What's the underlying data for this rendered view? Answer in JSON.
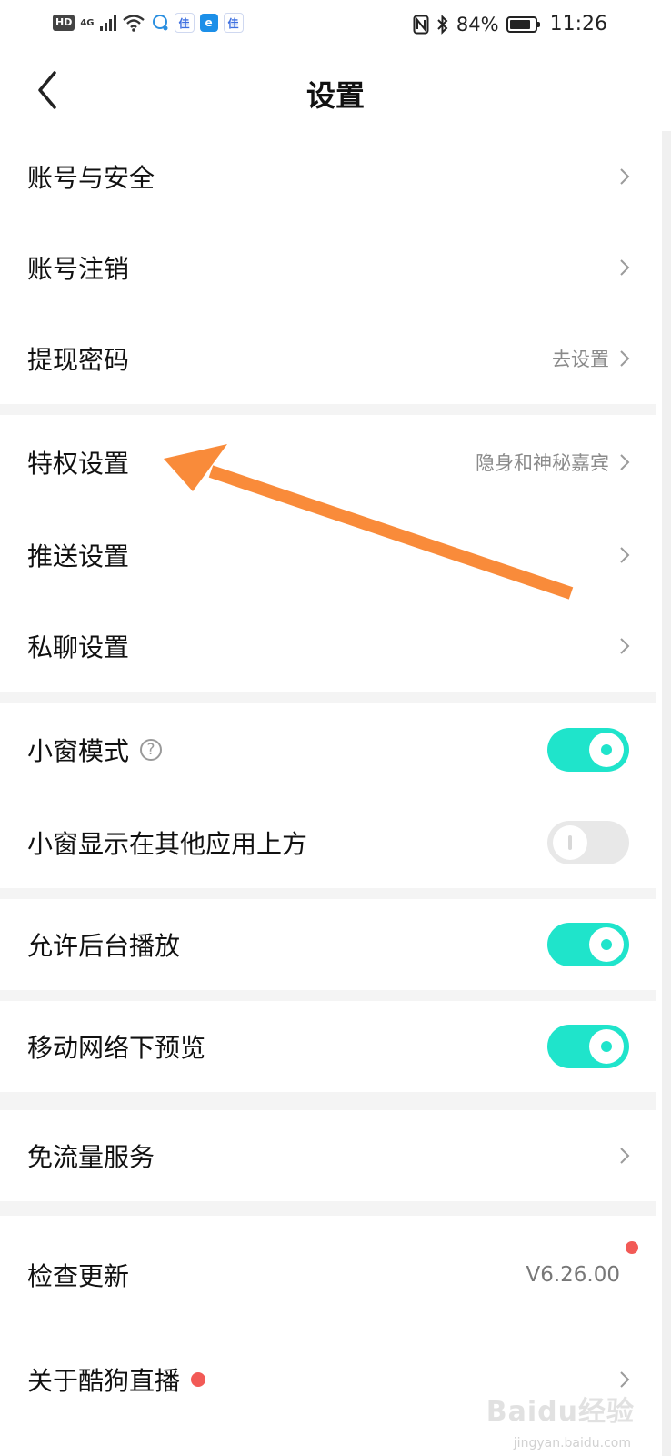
{
  "status_bar": {
    "hd": "HD",
    "network": "4G",
    "battery": "84%",
    "battery_level": 0.84,
    "time": "11:26"
  },
  "header": {
    "title": "设置"
  },
  "rows": {
    "account_security": {
      "label": "账号与安全"
    },
    "account_cancel": {
      "label": "账号注销"
    },
    "withdraw_password": {
      "label": "提现密码",
      "value": "去设置"
    },
    "privilege": {
      "label": "特权设置",
      "value": "隐身和神秘嘉宾"
    },
    "push": {
      "label": "推送设置"
    },
    "private_chat": {
      "label": "私聊设置"
    },
    "mini_window": {
      "label": "小窗模式",
      "help": "?",
      "on": true
    },
    "mini_window_overlay": {
      "label": "小窗显示在其他应用上方",
      "on": false
    },
    "background_play": {
      "label": "允许后台播放",
      "on": true
    },
    "mobile_preview": {
      "label": "移动网络下预览",
      "on": true
    },
    "free_traffic": {
      "label": "免流量服务"
    },
    "check_update": {
      "label": "检查更新",
      "value": "V6.26.00"
    },
    "about": {
      "label": "关于酷狗直播"
    }
  },
  "watermark": {
    "text": "Baidu经验",
    "sub": "jingyan.baidu.com"
  },
  "colors": {
    "toggle_on": "#1fe4cb",
    "annotation_arrow": "#f98b3a",
    "red_dot": "#f25a56"
  }
}
